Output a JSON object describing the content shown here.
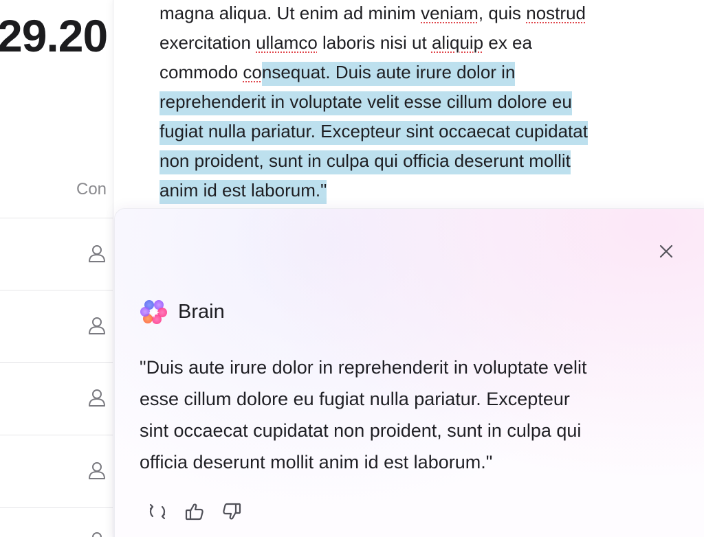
{
  "background_panel": {
    "big_number": "29.20",
    "column_header": "Con",
    "row_icon": "person-icon"
  },
  "document": {
    "lines": [
      {
        "before": "magna aliqua. Ut enim ad minim ",
        "spell1": "veniam",
        "mid": ", quis ",
        "spell2": "nostrud",
        "after": ""
      },
      {
        "before": "exercitation ",
        "spell1": "ullamco",
        "mid": " laboris nisi ut ",
        "spell2": "aliquip",
        "after": " ex ea"
      }
    ],
    "line3_plain": "commodo ",
    "line3_spell": "co",
    "line3_selected_spell": "n",
    "line3_selected": "sequat. Duis aute irure dolor in",
    "selected_lines": [
      "reprehenderit in voluptate velit esse cillum dolore eu",
      "fugiat nulla pariatur. Excepteur sint occaecat cupidatat",
      "non proident, sunt in culpa qui officia deserunt mollit",
      "anim id est laborum.\""
    ],
    "selection_color": "#bde0ee",
    "spellcheck_color": "#e0474c"
  },
  "ai_panel": {
    "title": "Brain",
    "logo": "brain-logo-icon",
    "answer_lines": [
      "\"Duis aute irure dolor in reprehenderit in voluptate velit",
      "esse cillum dolore eu fugiat nulla pariatur. Excepteur",
      "sint occaecat cupidatat non proident, sunt in culpa qui",
      "officia deserunt mollit anim id est laborum.\""
    ],
    "close_icon": "close-icon",
    "actions": [
      "regenerate-icon",
      "thumbs-up-icon",
      "thumbs-down-icon"
    ]
  }
}
